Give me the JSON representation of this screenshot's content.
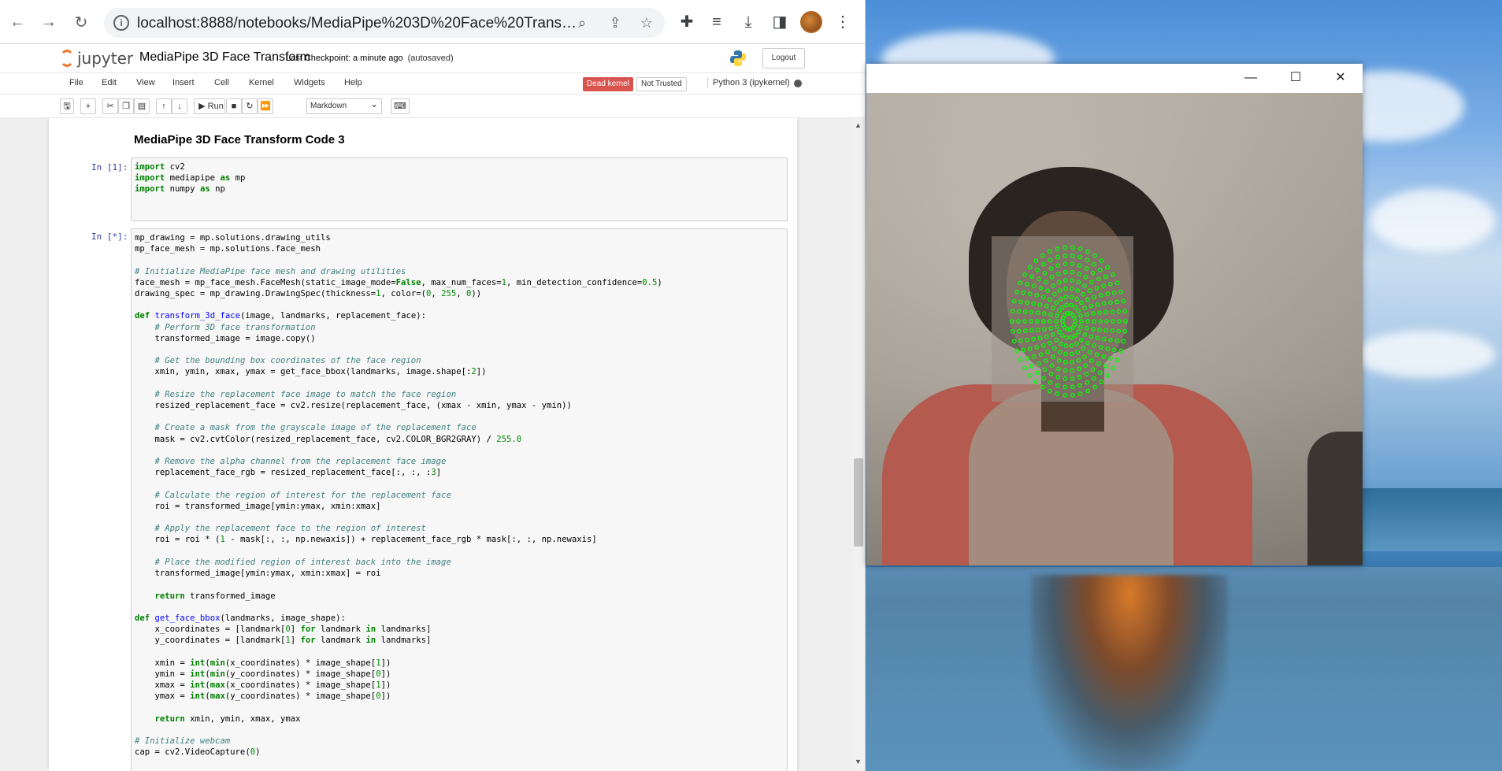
{
  "browser": {
    "url": "localhost:8888/notebooks/MediaPipe%203D%20Face%20Transform.i...",
    "icons": [
      "back-arrow-icon",
      "forward-arrow-icon",
      "reload-icon",
      "site-info-icon",
      "zoom-icon",
      "share-icon",
      "bookmark-star-icon",
      "extensions-icon",
      "media-icon",
      "download-icon",
      "sidebar-icon",
      "profile-avatar",
      "more-menu-icon"
    ]
  },
  "jupyter": {
    "logo_text": "jupyter",
    "notebook_title": "MediaPipe 3D Face Transform",
    "checkpoint": "Last Checkpoint: a minute ago",
    "autosave": "(autosaved)",
    "logout": "Logout",
    "menu": [
      "File",
      "Edit",
      "View",
      "Insert",
      "Cell",
      "Kernel",
      "Widgets",
      "Help"
    ],
    "kernel_status": "Dead kernel",
    "trust_status": "Not Trusted",
    "kernel_name": "Python 3 (ipykernel)",
    "run_label": "Run",
    "cell_type": "Markdown"
  },
  "notebook": {
    "heading": "MediaPipe 3D Face Transform Code 3",
    "cell1_prompt": "In [1]:",
    "cell1_lines": [
      "import cv2",
      "import mediapipe as mp",
      "import numpy as np"
    ],
    "cell2_prompt": "In [*]:",
    "cell2_lines": [
      "mp_drawing = mp.solutions.drawing_utils",
      "mp_face_mesh = mp.solutions.face_mesh",
      "",
      "# Initialize MediaPipe face mesh and drawing utilities",
      "face_mesh = mp_face_mesh.FaceMesh(static_image_mode=False, max_num_faces=1, min_detection_confidence=0.5)",
      "drawing_spec = mp_drawing.DrawingSpec(thickness=1, color=(0, 255, 0))",
      "",
      "def transform_3d_face(image, landmarks, replacement_face):",
      "    # Perform 3D face transformation",
      "    transformed_image = image.copy()",
      "",
      "    # Get the bounding box coordinates of the face region",
      "    xmin, ymin, xmax, ymax = get_face_bbox(landmarks, image.shape[:2])",
      "",
      "    # Resize the replacement face image to match the face region",
      "    resized_replacement_face = cv2.resize(replacement_face, (xmax - xmin, ymax - ymin))",
      "",
      "    # Create a mask from the grayscale image of the replacement face",
      "    mask = cv2.cvtColor(resized_replacement_face, cv2.COLOR_BGR2GRAY) / 255.0",
      "",
      "    # Remove the alpha channel from the replacement face image",
      "    replacement_face_rgb = resized_replacement_face[:, :, :3]",
      "",
      "    # Calculate the region of interest for the replacement face",
      "    roi = transformed_image[ymin:ymax, xmin:xmax]",
      "",
      "    # Apply the replacement face to the region of interest",
      "    roi = roi * (1 - mask[:, :, np.newaxis]) + replacement_face_rgb * mask[:, :, np.newaxis]",
      "",
      "    # Place the modified region of interest back into the image",
      "    transformed_image[ymin:ymax, xmin:xmax] = roi",
      "",
      "    return transformed_image",
      "",
      "def get_face_bbox(landmarks, image_shape):",
      "    x_coordinates = [landmark[0] for landmark in landmarks]",
      "    y_coordinates = [landmark[1] for landmark in landmarks]",
      "",
      "    xmin = int(min(x_coordinates) * image_shape[1])",
      "    ymin = int(min(y_coordinates) * image_shape[0])",
      "    xmax = int(max(x_coordinates) * image_shape[1])",
      "    ymax = int(max(y_coordinates) * image_shape[0])",
      "",
      "    return xmin, ymin, xmax, ymax",
      "",
      "# Initialize webcam",
      "cap = cv2.VideoCapture(0)"
    ]
  },
  "cv_window": {
    "controls": [
      "minimize-icon",
      "maximize-icon",
      "close-icon"
    ],
    "mesh_color": "#00ff00"
  },
  "colors": {
    "dead_kernel": "#d9534f",
    "prompt": "#303f9f",
    "keyword": "#008000",
    "comment": "#408080"
  }
}
